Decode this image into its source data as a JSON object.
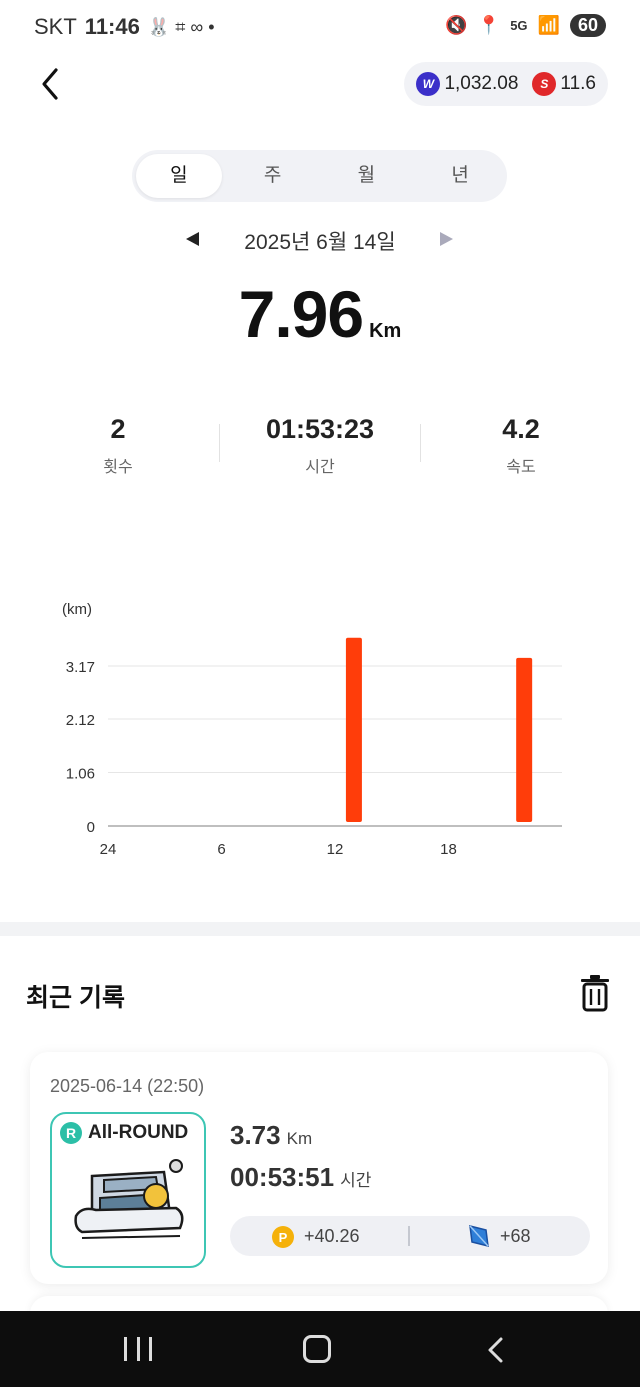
{
  "status_bar": {
    "carrier": "SKT",
    "time": "11:46",
    "network": "5G",
    "battery": "60"
  },
  "header": {
    "balances": [
      {
        "icon": "w-token-icon",
        "value": "1,032.08",
        "color": "#3b2fc9"
      },
      {
        "icon": "s-token-icon",
        "value": "11.6",
        "color": "#e0282a"
      }
    ]
  },
  "tabs": [
    {
      "label": "일",
      "active": true
    },
    {
      "label": "주",
      "active": false
    },
    {
      "label": "월",
      "active": false
    },
    {
      "label": "년",
      "active": false
    }
  ],
  "date": {
    "label": "2025년 6월 14일"
  },
  "distance": {
    "value": "7.96",
    "unit": "Km"
  },
  "stats": [
    {
      "value": "2",
      "label": "횟수"
    },
    {
      "value": "01:53:23",
      "label": "시간"
    },
    {
      "value": "4.2",
      "label": "속도"
    }
  ],
  "chart_data": {
    "type": "bar",
    "ylabel": "(km)",
    "yticks": [
      "0",
      "1.06",
      "2.12",
      "3.17"
    ],
    "ylim": [
      0,
      3.17
    ],
    "xticks": [
      "24",
      "6",
      "12",
      "18"
    ],
    "xlim": [
      0,
      24
    ],
    "bars": [
      {
        "hour": 13,
        "value": 3.73
      },
      {
        "hour": 22,
        "value": 3.33
      }
    ],
    "bar_color": "#ff3d0a",
    "grid": true
  },
  "recent": {
    "title": "최근 기록",
    "records": [
      {
        "date": "2025-06-14 (22:50)",
        "badge": "R",
        "shoe_type": "All-ROUND",
        "distance": "3.73",
        "distance_unit": "Km",
        "time": "00:53:51",
        "time_unit": "시간",
        "points": "+40.26",
        "gems": "+68"
      }
    ]
  }
}
